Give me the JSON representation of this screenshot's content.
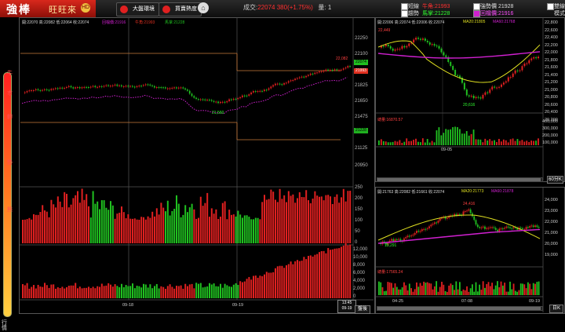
{
  "topbar": {
    "logo_main": "強棒",
    "logo_sub": "旺旺來",
    "logo_badge": "HD",
    "btn_market": "大盤環境",
    "btn_sector": "買賣熱度",
    "home_icon": "home-icon",
    "trade_label": "成交:",
    "trade_price": "22074",
    "trade_change": "380(+1.75%)",
    "volume_label": "量: 1",
    "opts": [
      {
        "label": "短線",
        "checked": true
      },
      {
        "label": "趨勢",
        "checked": false
      }
    ],
    "moneyline_label": "牛角:",
    "moneyline_value": "21993",
    "horse_label": "馬掌:",
    "horse_value": "21228",
    "strength_label": "強勢價",
    "strength_value": "21928",
    "pullback_label": "回檔價",
    "pullback_value": "21916",
    "dual_label": "雙線",
    "mode_label": "模式"
  },
  "gauge": {
    "chars": [
      "牛",
      "市",
      "轉",
      "勢",
      "熊",
      "行",
      "情"
    ]
  },
  "main": {
    "legend_ohlc": "開:22070 高:22082 低:22064 收:22074",
    "legend_extra": "回檔價:21916",
    "legend_bull": "牛角:21993",
    "legend_horse": "馬掌:21228",
    "price_axis": [
      "22250",
      "22100",
      "21950",
      "21825",
      "21650",
      "21475",
      "21300",
      "21125",
      "20950"
    ],
    "badges": [
      {
        "label": "22074",
        "color": "#20c020"
      },
      {
        "label": "21993",
        "color": "#e03020"
      },
      {
        "label": "21228",
        "color": "#20b020"
      }
    ],
    "low_label": "21,560",
    "high_label": "22,082",
    "vol_axis": [
      "250",
      "200",
      "150",
      "100",
      "50",
      "0"
    ],
    "amt_axis": [
      "12,000",
      "10,000",
      "8,000",
      "6,000",
      "4,000",
      "2,000",
      "0"
    ],
    "x_labels": [
      "09-18",
      "09-19"
    ],
    "time_box": [
      "13:45",
      "09-19"
    ],
    "mode_btn": "盤後"
  },
  "daily": {
    "legend": "開:22006 高:22074 低:22006 收:22074",
    "ma20_label": "MA20:21805",
    "ma60_label": "MA60:21768",
    "high_label": "22,449",
    "low_label": "20,616",
    "axis": [
      "22,800",
      "22,600",
      "22,400",
      "22,200",
      "22,000",
      "21,800",
      "21,600",
      "21,400",
      "21,200",
      "21,000",
      "20,800",
      "20,600",
      "20,400",
      "20,200"
    ],
    "vol_legend": "總量:16870.57",
    "vol_axis": [
      "400,000",
      "300,000",
      "200,000",
      "100,000"
    ],
    "x_label": "09-05",
    "period_btn": "60分K"
  },
  "weekly": {
    "legend": "開:21763 高:22082 低:21661 收:22074",
    "ma20_label": "MA20:21773",
    "ma60_label": "MA60:21878",
    "high_label": "24,416",
    "low_label": "19,291",
    "axis": [
      "24,000",
      "23,000",
      "22,000",
      "21,000",
      "20,000",
      "19,000"
    ],
    "vol_legend": "總量:17565.24",
    "vol_axis": [
      "",
      ""
    ],
    "x_labels": [
      "04-25",
      "07-08",
      "09-19"
    ],
    "period_btn": "日K"
  },
  "colors": {
    "up": "#e02020",
    "down": "#20c020",
    "ma_yellow": "#e0e020",
    "ma_magenta": "#d020d0",
    "stop_line": "#c87a3a"
  }
}
